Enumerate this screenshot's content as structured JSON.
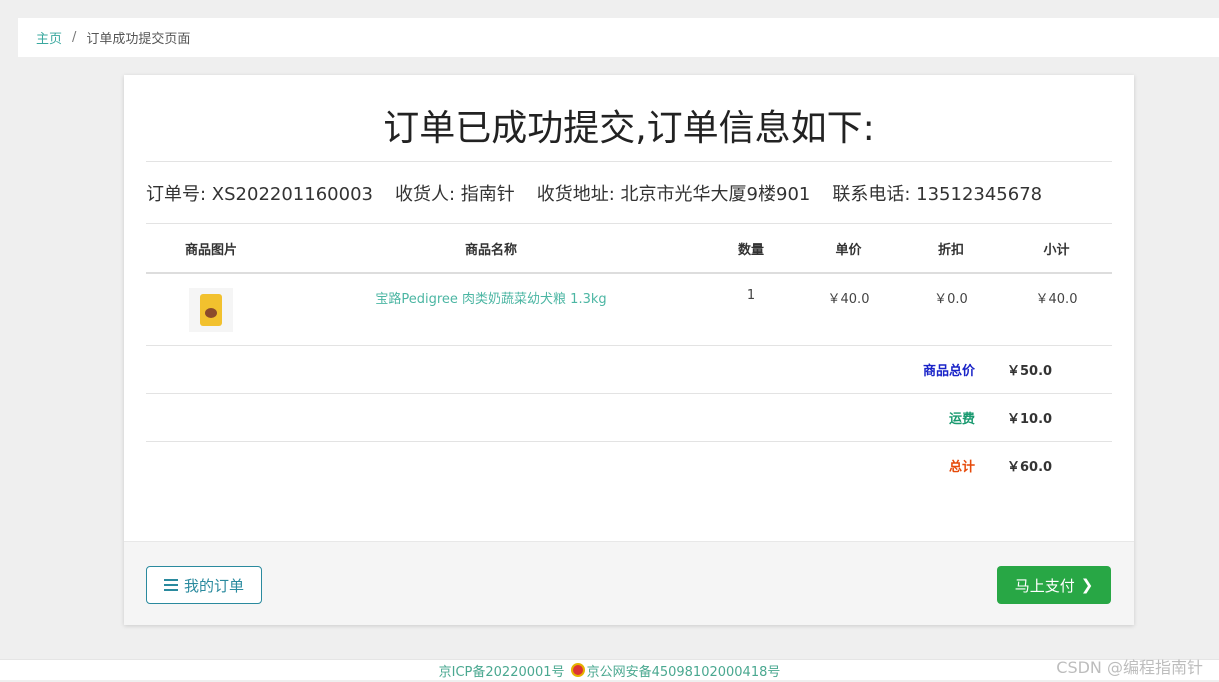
{
  "breadcrumb": {
    "home": "主页",
    "separator": "/",
    "current": "订单成功提交页面"
  },
  "heading": "订单已成功提交,订单信息如下:",
  "order_info": {
    "order_no": "订单号: XS202201160003",
    "receiver": "收货人: 指南针",
    "address": "收货地址: 北京市光华大厦9楼901",
    "phone": "联系电话: 13512345678"
  },
  "table": {
    "headers": [
      "商品图片",
      "商品名称",
      "数量",
      "单价",
      "折扣",
      "小计"
    ],
    "rows": [
      {
        "name": "宝路Pedigree 肉类奶蔬菜幼犬粮 1.3kg",
        "qty": "1",
        "price": "￥40.0",
        "discount": "￥0.0",
        "subtotal": "￥40.0"
      }
    ]
  },
  "summary": {
    "goods_total_label": "商品总价",
    "goods_total": "￥50.0",
    "shipping_label": "运费",
    "shipping": "￥10.0",
    "total_label": "总计",
    "total": "￥60.0"
  },
  "buttons": {
    "my_orders": "我的订单",
    "pay_now": "马上支付"
  },
  "footer": {
    "icp": "京ICP备20220001号",
    "police": "京公网安备45098102000418号"
  },
  "watermark": "CSDN @编程指南针",
  "colors": {
    "accent": "#3aa89f",
    "pay": "#28a745",
    "goods_total": "#1a24c8",
    "shipping": "#1a9a70",
    "total": "#e64a0a"
  }
}
